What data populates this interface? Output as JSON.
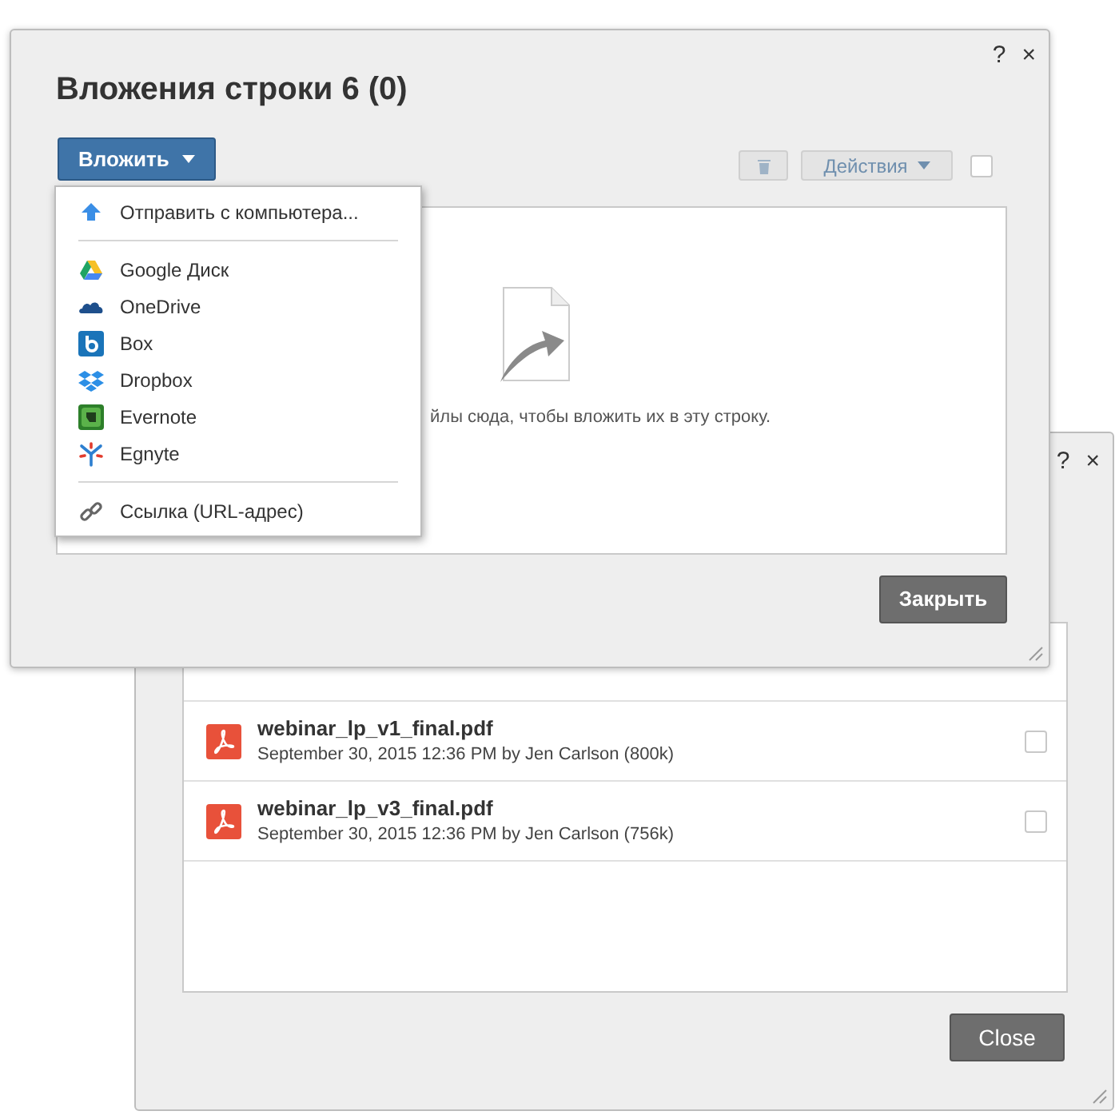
{
  "back_window": {
    "help": "?",
    "close": "×",
    "files": [
      {
        "name": "webinar_lp_v1_final.pdf",
        "meta": "September 30, 2015 12:36 PM by Jen Carlson (800k)",
        "checked": false
      },
      {
        "name": "webinar_lp_v3_final.pdf",
        "meta": "September 30, 2015 12:36 PM by Jen Carlson (756k)",
        "checked": false
      }
    ],
    "close_button": "Close"
  },
  "front_window": {
    "title": "Вложения строки 6 (0)",
    "help": "?",
    "close": "×",
    "attach_button": "Вложить",
    "actions_button": {
      "label": "Действия",
      "disabled": true
    },
    "select_all": {
      "checked": false
    },
    "drop_hint": "йлы сюда, чтобы вложить их в эту строку.",
    "close_button": "Закрыть"
  },
  "attach_menu": {
    "items": [
      {
        "kind": "upload",
        "label": "Отправить с компьютера..."
      },
      {
        "kind": "separator"
      },
      {
        "kind": "google-drive",
        "label": "Google Диск"
      },
      {
        "kind": "onedrive",
        "label": "OneDrive"
      },
      {
        "kind": "box",
        "label": "Box"
      },
      {
        "kind": "dropbox",
        "label": "Dropbox"
      },
      {
        "kind": "evernote",
        "label": "Evernote"
      },
      {
        "kind": "egnyte",
        "label": "Egnyte"
      },
      {
        "kind": "separator"
      },
      {
        "kind": "link",
        "label": "Ссылка (URL-адрес)"
      }
    ]
  }
}
